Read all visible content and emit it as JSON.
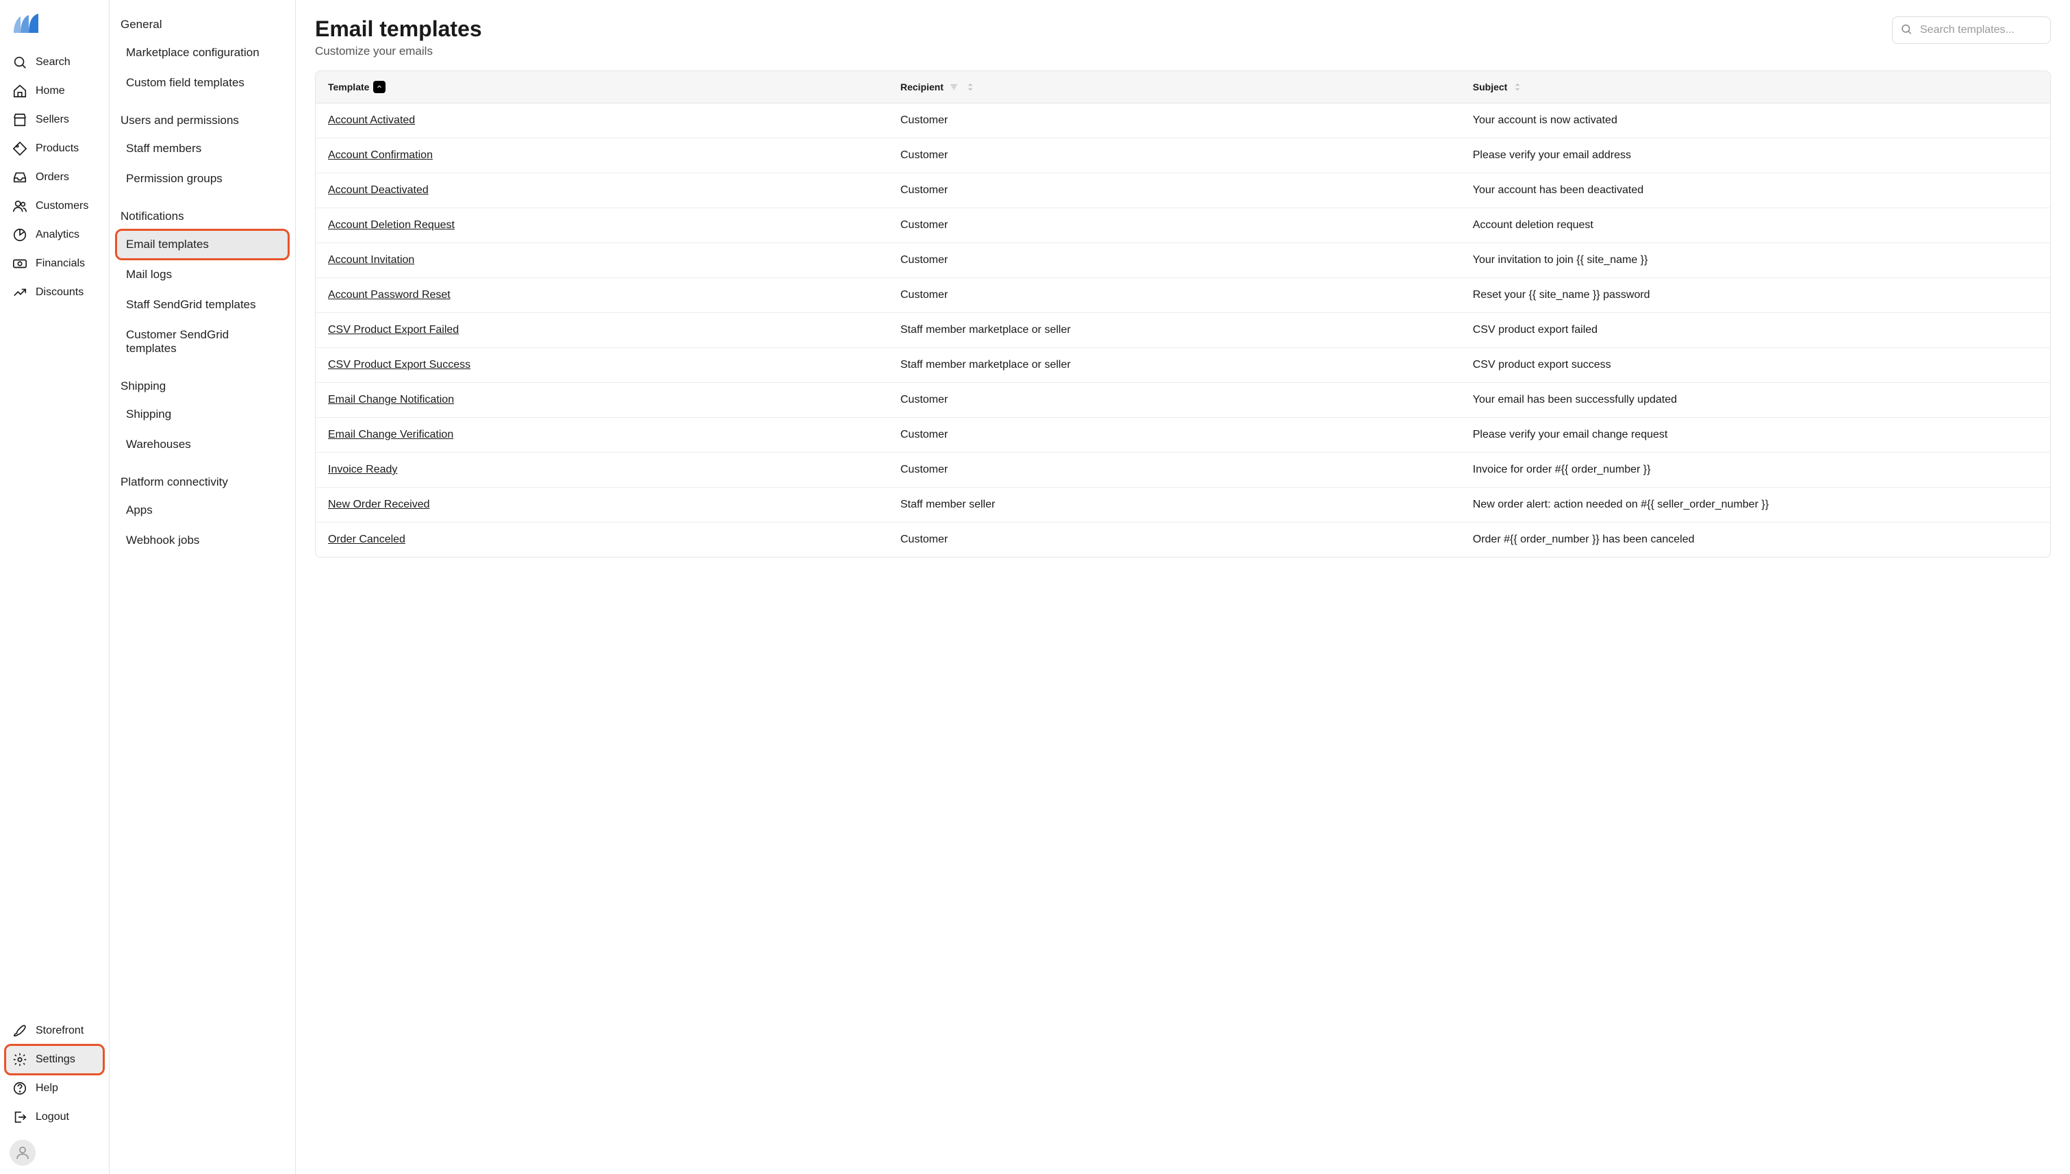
{
  "nav": {
    "items": [
      {
        "id": "search",
        "label": "Search"
      },
      {
        "id": "home",
        "label": "Home"
      },
      {
        "id": "sellers",
        "label": "Sellers"
      },
      {
        "id": "products",
        "label": "Products"
      },
      {
        "id": "orders",
        "label": "Orders"
      },
      {
        "id": "customers",
        "label": "Customers"
      },
      {
        "id": "analytics",
        "label": "Analytics"
      },
      {
        "id": "financials",
        "label": "Financials"
      },
      {
        "id": "discounts",
        "label": "Discounts"
      }
    ],
    "bottom": [
      {
        "id": "storefront",
        "label": "Storefront"
      },
      {
        "id": "settings",
        "label": "Settings"
      },
      {
        "id": "help",
        "label": "Help"
      },
      {
        "id": "logout",
        "label": "Logout"
      }
    ]
  },
  "settings_nav": {
    "groups": [
      {
        "title": "General",
        "items": [
          {
            "id": "marketplace-config",
            "label": "Marketplace configuration"
          },
          {
            "id": "custom-field-templates",
            "label": "Custom field templates"
          }
        ]
      },
      {
        "title": "Users and permissions",
        "items": [
          {
            "id": "staff-members",
            "label": "Staff members"
          },
          {
            "id": "permission-groups",
            "label": "Permission groups"
          }
        ]
      },
      {
        "title": "Notifications",
        "items": [
          {
            "id": "email-templates",
            "label": "Email templates"
          },
          {
            "id": "mail-logs",
            "label": "Mail logs"
          },
          {
            "id": "staff-sendgrid",
            "label": "Staff SendGrid templates"
          },
          {
            "id": "customer-sendgrid",
            "label": "Customer SendGrid templates"
          }
        ]
      },
      {
        "title": "Shipping",
        "items": [
          {
            "id": "shipping",
            "label": "Shipping"
          },
          {
            "id": "warehouses",
            "label": "Warehouses"
          }
        ]
      },
      {
        "title": "Platform connectivity",
        "items": [
          {
            "id": "apps",
            "label": "Apps"
          },
          {
            "id": "webhook-jobs",
            "label": "Webhook jobs"
          }
        ]
      }
    ]
  },
  "page": {
    "title": "Email templates",
    "subtitle": "Customize your emails",
    "search_placeholder": "Search templates..."
  },
  "table": {
    "columns": {
      "template": "Template",
      "recipient": "Recipient",
      "subject": "Subject"
    },
    "rows": [
      {
        "template": "Account Activated",
        "recipient": "Customer",
        "subject": "Your account is now activated"
      },
      {
        "template": "Account Confirmation",
        "recipient": "Customer",
        "subject": "Please verify your email address"
      },
      {
        "template": "Account Deactivated",
        "recipient": "Customer",
        "subject": "Your account has been deactivated"
      },
      {
        "template": "Account Deletion Request",
        "recipient": "Customer",
        "subject": "Account deletion request"
      },
      {
        "template": "Account Invitation",
        "recipient": "Customer",
        "subject": "Your invitation to join {{ site_name }}"
      },
      {
        "template": "Account Password Reset",
        "recipient": "Customer",
        "subject": "Reset your {{ site_name }} password"
      },
      {
        "template": "CSV Product Export Failed",
        "recipient": "Staff member marketplace or seller",
        "subject": "CSV product export failed"
      },
      {
        "template": "CSV Product Export Success",
        "recipient": "Staff member marketplace or seller",
        "subject": "CSV product export success"
      },
      {
        "template": "Email Change Notification",
        "recipient": "Customer",
        "subject": "Your email has been successfully updated"
      },
      {
        "template": "Email Change Verification",
        "recipient": "Customer",
        "subject": "Please verify your email change request"
      },
      {
        "template": "Invoice Ready",
        "recipient": "Customer",
        "subject": "Invoice for order #{{ order_number }}"
      },
      {
        "template": "New Order Received",
        "recipient": "Staff member seller",
        "subject": "New order alert: action needed on #{{ seller_order_number }}"
      },
      {
        "template": "Order Canceled",
        "recipient": "Customer",
        "subject": "Order #{{ order_number }} has been canceled"
      }
    ]
  }
}
